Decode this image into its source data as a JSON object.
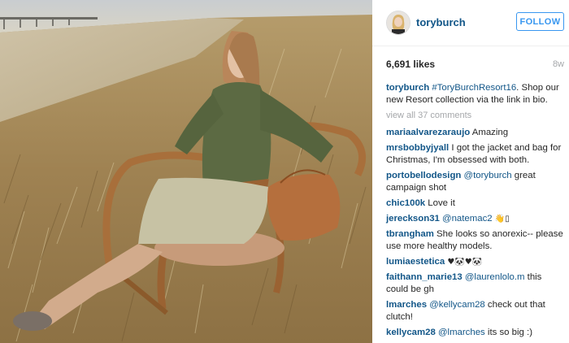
{
  "post": {
    "photo_alt": "fashion-photo",
    "author": "toryburch",
    "follow_label": "FOLLOW",
    "likes": "6,691 likes",
    "age": "8w",
    "caption": {
      "user": "toryburch",
      "hashtag": "#ToryBurchResort16",
      "text": ". Shop our new Resort collection via the link in bio."
    },
    "view_all": "view all 37 comments",
    "comments": [
      {
        "user": "mariaalvarezaraujo",
        "text": " Amazing"
      },
      {
        "user": "mrsbobbyjyall",
        "text": " I got the jacket and bag for Christmas, I'm obsessed with both."
      },
      {
        "user": "portobellodesign",
        "mention": " @toryburch",
        "text": " great campaign shot"
      },
      {
        "user": "chic100k",
        "text": " Love it"
      },
      {
        "user": "jereckson31",
        "mention": " @natemac2",
        "text": " 👋▯"
      },
      {
        "user": "tbrangham",
        "text": " She looks so anorexic-- please use more healthy models."
      },
      {
        "user": "lumiaestetica",
        "text": " ♥🐼♥🐼"
      },
      {
        "user": "faithann_marie13",
        "mention": " @laurenlolo.m",
        "text": " this could be gh"
      },
      {
        "user": "lmarches",
        "mention": " @kellycam28",
        "text": " check out that clutch!"
      },
      {
        "user": "kellycam28",
        "mention": " @lmarches",
        "text": " its so big :)"
      }
    ]
  },
  "colors": {
    "username": "#125688",
    "follow": "#3897f0",
    "muted": "#a5a7aa",
    "text": "#262626"
  },
  "icons": [
    "profile-avatar-icon"
  ]
}
